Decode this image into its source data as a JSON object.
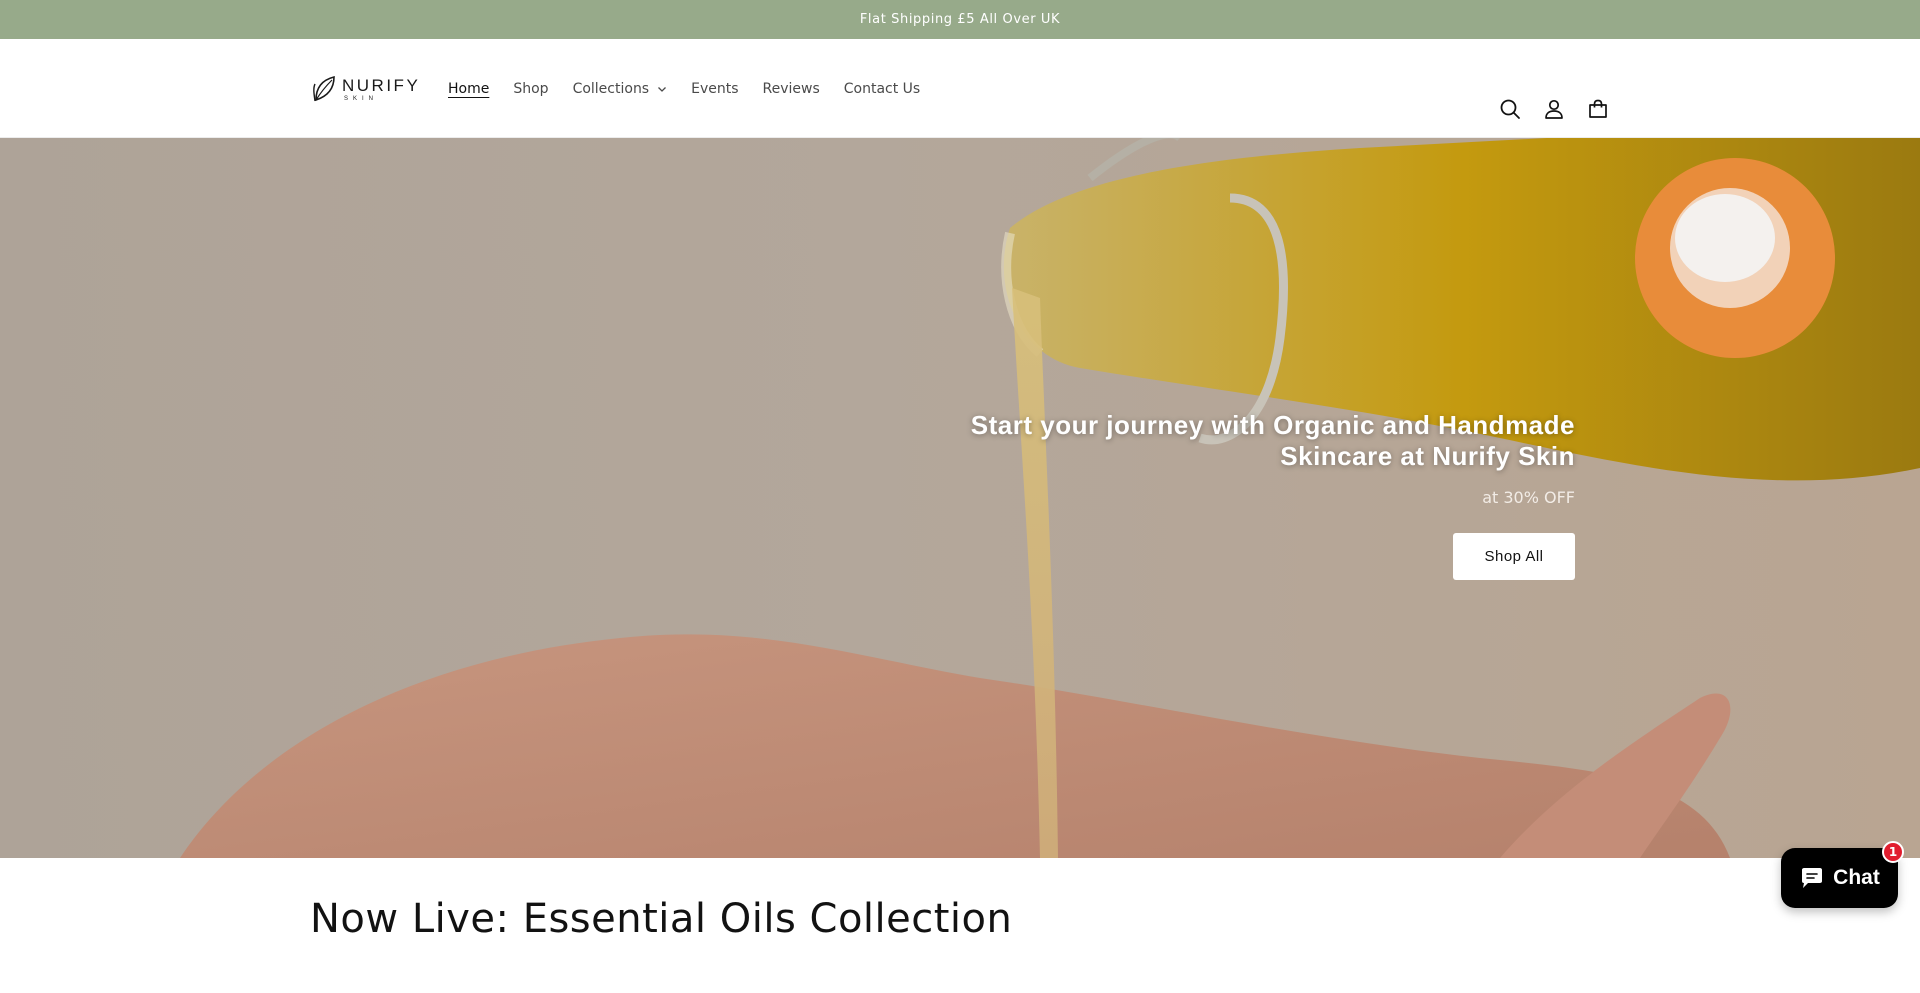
{
  "announcement": {
    "text": "Flat Shipping £5 All Over UK"
  },
  "logo": {
    "word": "NURIFY",
    "sub": "SKIN"
  },
  "nav": {
    "items": [
      {
        "label": "Home",
        "active": true
      },
      {
        "label": "Shop"
      },
      {
        "label": "Collections",
        "has_dropdown": true
      },
      {
        "label": "Events"
      },
      {
        "label": "Reviews"
      },
      {
        "label": "Contact Us"
      }
    ]
  },
  "header_icons": [
    "search-icon",
    "account-icon",
    "cart-icon"
  ],
  "hero": {
    "title": "Start your journey with Organic and Handmade Skincare at Nurify Skin",
    "subtitle": "at 30% OFF",
    "button_label": "Shop All"
  },
  "section": {
    "title": "Now Live: Essential Oils Collection"
  },
  "chat": {
    "label": "Chat",
    "badge": "1"
  },
  "colors": {
    "announcement_bg": "#97aa8a",
    "chat_bg": "#000000",
    "badge_bg": "#e11d2e"
  }
}
